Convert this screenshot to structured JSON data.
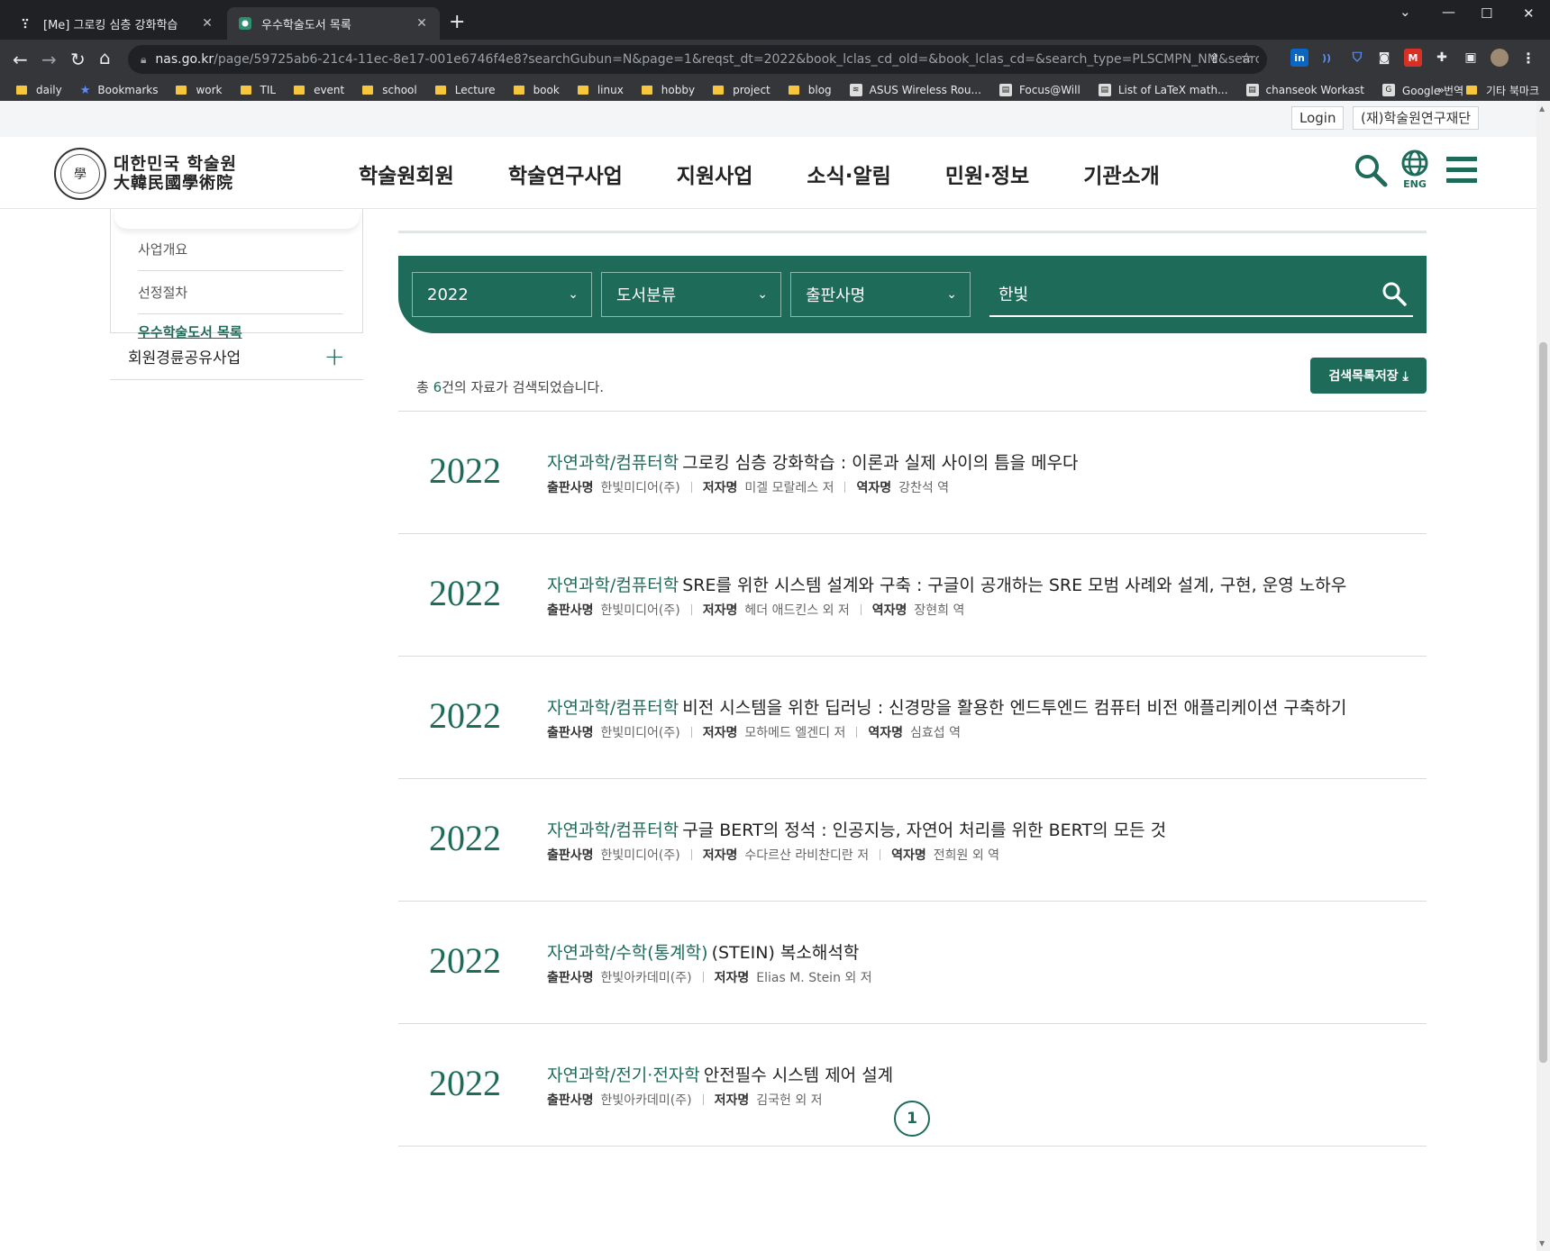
{
  "browser": {
    "tabs": [
      {
        "title": "[Me] 그로킹 심층 강화학습",
        "favicon": "notion-icon",
        "active": false
      },
      {
        "title": "우수학술도서 목록",
        "favicon": "nas-icon",
        "active": true
      }
    ],
    "url_host": "nas.go.kr",
    "url_path": "/page/59725ab6-21c4-11ec-8e17-001e6746f4e8?searchGubun=N&page=1&reqst_dt=2022&book_lclas_cd_old=&book_lclas_cd=&search_type=PLSCMPN_NM&search_text=...",
    "bookmarks": [
      {
        "label": "daily",
        "icon": "folder-icon"
      },
      {
        "label": "Bookmarks",
        "icon": "star-icon"
      },
      {
        "label": "work",
        "icon": "folder-icon"
      },
      {
        "label": "TIL",
        "icon": "folder-icon"
      },
      {
        "label": "event",
        "icon": "folder-icon"
      },
      {
        "label": "school",
        "icon": "folder-icon"
      },
      {
        "label": "Lecture",
        "icon": "folder-icon"
      },
      {
        "label": "book",
        "icon": "folder-icon"
      },
      {
        "label": "linux",
        "icon": "folder-icon"
      },
      {
        "label": "hobby",
        "icon": "folder-icon"
      },
      {
        "label": "project",
        "icon": "folder-icon"
      },
      {
        "label": "blog",
        "icon": "folder-icon"
      },
      {
        "label": "ASUS Wireless Rou...",
        "icon": "wifi-icon"
      },
      {
        "label": "Focus@Will",
        "icon": "page-icon"
      },
      {
        "label": "List of LaTeX math...",
        "icon": "page-icon"
      },
      {
        "label": "chanseok Workast",
        "icon": "page-icon"
      },
      {
        "label": "Google 번역",
        "icon": "translate-icon"
      }
    ],
    "bookmarks_overflow": "»",
    "other_bookmarks": "기타 북마크"
  },
  "site": {
    "util_login": "Login",
    "util_foundation": "(재)학술원연구재단",
    "logo_line1": "대한민국 학술원",
    "logo_line2": "大韓民國學術院",
    "menu": [
      "학술원회원",
      "학술연구사업",
      "지원사업",
      "소식·알림",
      "민원·정보",
      "기관소개"
    ],
    "lang_label": "ENG"
  },
  "sidebar": {
    "items": [
      "사업개요",
      "선정절차",
      "우수학술도서 목록"
    ],
    "group": "회원경륜공유사업"
  },
  "search": {
    "year": "2022",
    "category": "도서분류",
    "type": "출판사명",
    "query": "한빛"
  },
  "results": {
    "prefix": "총 ",
    "count": "6",
    "suffix": "건의 자료가 검색되었습니다.",
    "save_button": "검색목록저장 ⤓",
    "labels": {
      "publisher": "출판사명",
      "author": "저자명",
      "translator": "역자명"
    },
    "items": [
      {
        "year": "2022",
        "category": "자연과학/컴퓨터학",
        "title": "그로킹 심층 강화학습 : 이론과 실제 사이의 틈을 메우다",
        "publisher": "한빛미디어(주)",
        "author": "미겔 모랄레스 저",
        "translator": "강찬석 역"
      },
      {
        "year": "2022",
        "category": "자연과학/컴퓨터학",
        "title": "SRE를 위한 시스템 설계와 구축 : 구글이 공개하는 SRE 모범 사례와 설계, 구현, 운영 노하우",
        "publisher": "한빛미디어(주)",
        "author": "헤더 애드킨스 외 저",
        "translator": "장현희 역"
      },
      {
        "year": "2022",
        "category": "자연과학/컴퓨터학",
        "title": "비전 시스템을 위한 딥러닝 : 신경망을 활용한 엔드투엔드 컴퓨터 비전 애플리케이션 구축하기",
        "publisher": "한빛미디어(주)",
        "author": "모하메드 엘겐디 저",
        "translator": "심효섭 역"
      },
      {
        "year": "2022",
        "category": "자연과학/컴퓨터학",
        "title": "구글 BERT의 정석 : 인공지능, 자연어 처리를 위한 BERT의 모든 것",
        "publisher": "한빛미디어(주)",
        "author": "수다르산 라비찬디란 저",
        "translator": "전희원 외 역"
      },
      {
        "year": "2022",
        "category": "자연과학/수학(통계학)",
        "title": "(STEIN) 복소해석학",
        "publisher": "한빛아카데미(주)",
        "author": "Elias M. Stein 외 저",
        "translator": ""
      },
      {
        "year": "2022",
        "category": "자연과학/전기·전자학",
        "title": "안전필수 시스템 제어 설계",
        "publisher": "한빛아카데미(주)",
        "author": "김국헌 외 저",
        "translator": ""
      }
    ]
  },
  "pagination": {
    "current": "1"
  },
  "colors": {
    "brand": "#1e6b5a",
    "chrome_dark": "#202124",
    "chrome_mid": "#35363a"
  }
}
